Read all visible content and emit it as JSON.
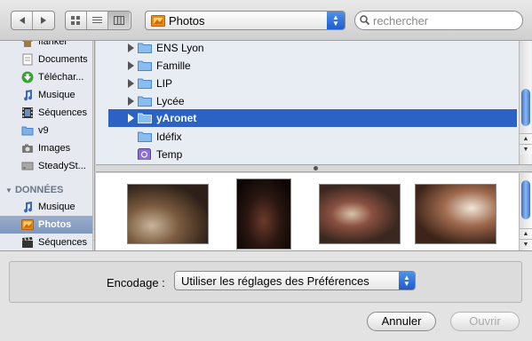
{
  "toolbar": {
    "location": "Photos",
    "search_placeholder": "rechercher"
  },
  "sidebar": {
    "items_top": [
      {
        "label": "flanker",
        "icon": "home-icon"
      },
      {
        "label": "Documents",
        "icon": "document-icon"
      },
      {
        "label": "Téléchar...",
        "icon": "download-icon"
      },
      {
        "label": "Musique",
        "icon": "music-icon"
      },
      {
        "label": "Séquences",
        "icon": "film-icon"
      },
      {
        "label": "v9",
        "icon": "folder-icon"
      },
      {
        "label": "Images",
        "icon": "camera-icon"
      },
      {
        "label": "SteadySt...",
        "icon": "drive-icon"
      }
    ],
    "section": "DONNÉES",
    "items_bottom": [
      {
        "label": "Musique",
        "icon": "music-icon"
      },
      {
        "label": "Photos",
        "icon": "photos-icon",
        "selected": true
      },
      {
        "label": "Séquences",
        "icon": "film-icon"
      }
    ]
  },
  "files": [
    {
      "name": "ENS Lyon",
      "expandable": true
    },
    {
      "name": "Famille",
      "expandable": true
    },
    {
      "name": "LIP",
      "expandable": true
    },
    {
      "name": "Lycée",
      "expandable": true
    },
    {
      "name": "yAronet",
      "expandable": true,
      "selected": true
    },
    {
      "name": "Idéfix",
      "expandable": false
    },
    {
      "name": "Temp",
      "expandable": false,
      "icon": "app-folder-icon"
    }
  ],
  "bottom": {
    "encoding_label": "Encodage :",
    "encoding_value": "Utiliser les réglages des Préférences",
    "cancel": "Annuler",
    "open": "Ouvrir"
  },
  "colors": {
    "selection": "#2c62c4",
    "sidebar_selection": "#8ba2c6",
    "scroll_thumb": "#4a82d6"
  }
}
